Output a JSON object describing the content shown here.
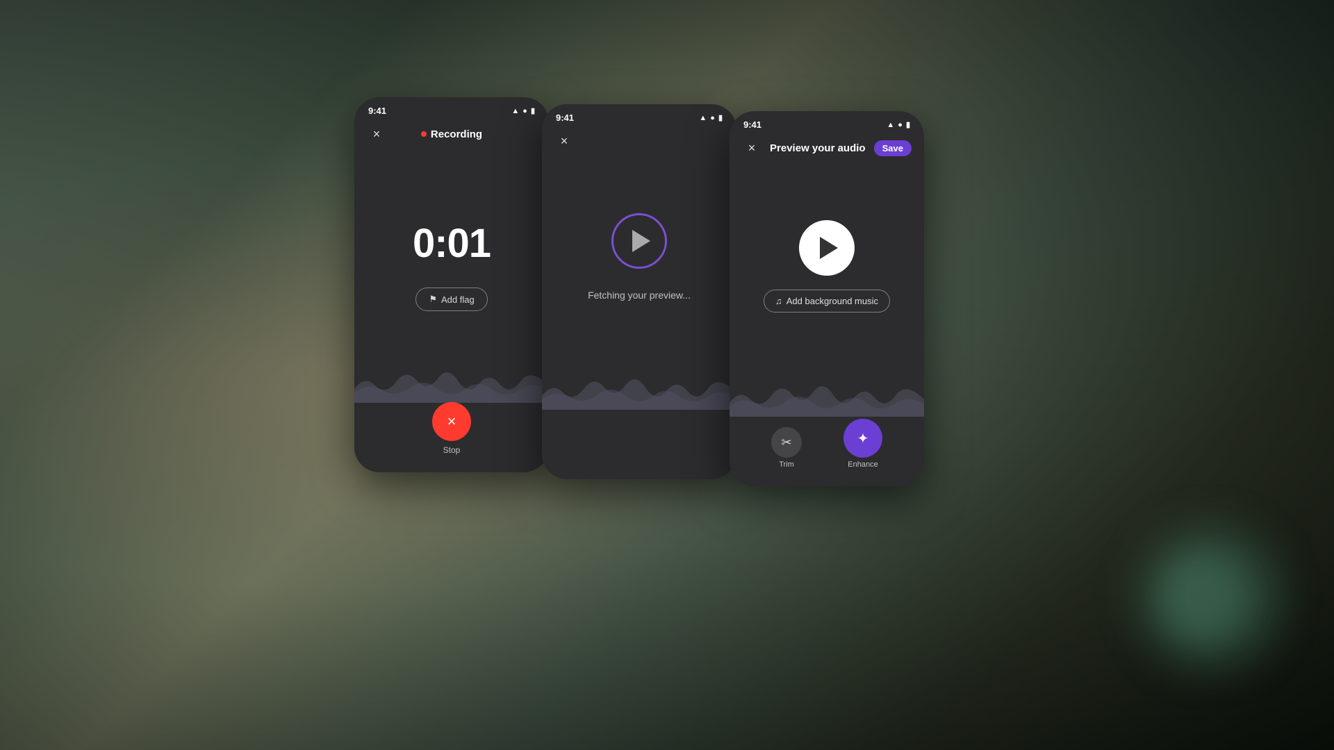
{
  "background": {
    "color": "#2a3a2a"
  },
  "phone1": {
    "status_time": "9:41",
    "header_title": "Recording",
    "timer": "0:01",
    "add_flag_label": "Add flag",
    "stop_label": "Stop",
    "close_icon": "×"
  },
  "phone2": {
    "status_time": "9:41",
    "fetching_text": "Fetching your preview...",
    "close_icon": "×"
  },
  "phone3": {
    "status_time": "9:41",
    "header_title": "Preview your audio",
    "save_label": "Save",
    "add_music_label": "Add background music",
    "trim_label": "Trim",
    "enhance_label": "Enhance",
    "close_icon": "×"
  },
  "icons": {
    "signal": "▲▲▲",
    "wifi": "wifi",
    "battery": "▮▮▮",
    "flag": "⚑",
    "music_note": "♫",
    "scissors": "✂",
    "sparkles": "✦"
  }
}
